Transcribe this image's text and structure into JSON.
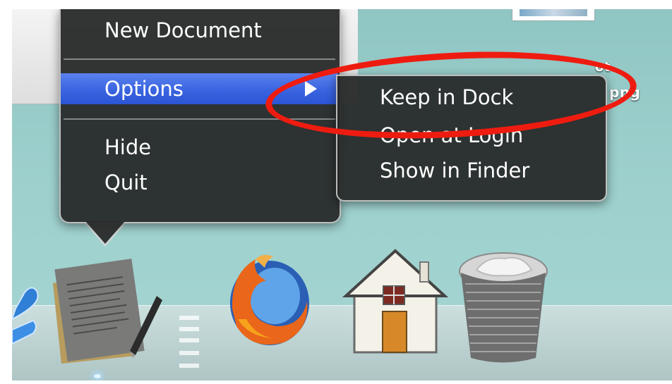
{
  "context_menu": {
    "items": [
      {
        "label": "New Document"
      },
      {
        "label": "Options",
        "selected": true,
        "has_submenu": true
      },
      {
        "label": "Hide"
      },
      {
        "label": "Quit"
      }
    ]
  },
  "submenu": {
    "items": [
      {
        "label": "Keep in Dock",
        "highlighted_by_annotation": true
      },
      {
        "label": "Open at Login"
      },
      {
        "label": "Show in Finder"
      }
    ]
  },
  "desktop": {
    "file_label_top": "ot",
    "file_label_bottom": "png"
  },
  "dock": {
    "icons": [
      "textedit-icon",
      "firefox-icon",
      "home-folder-icon",
      "trash-icon"
    ]
  },
  "colors": {
    "menu_bg": "#262828",
    "selection": "#3a64e0",
    "annotation": "#ee1c10",
    "desktop": "#9dd0cd"
  }
}
